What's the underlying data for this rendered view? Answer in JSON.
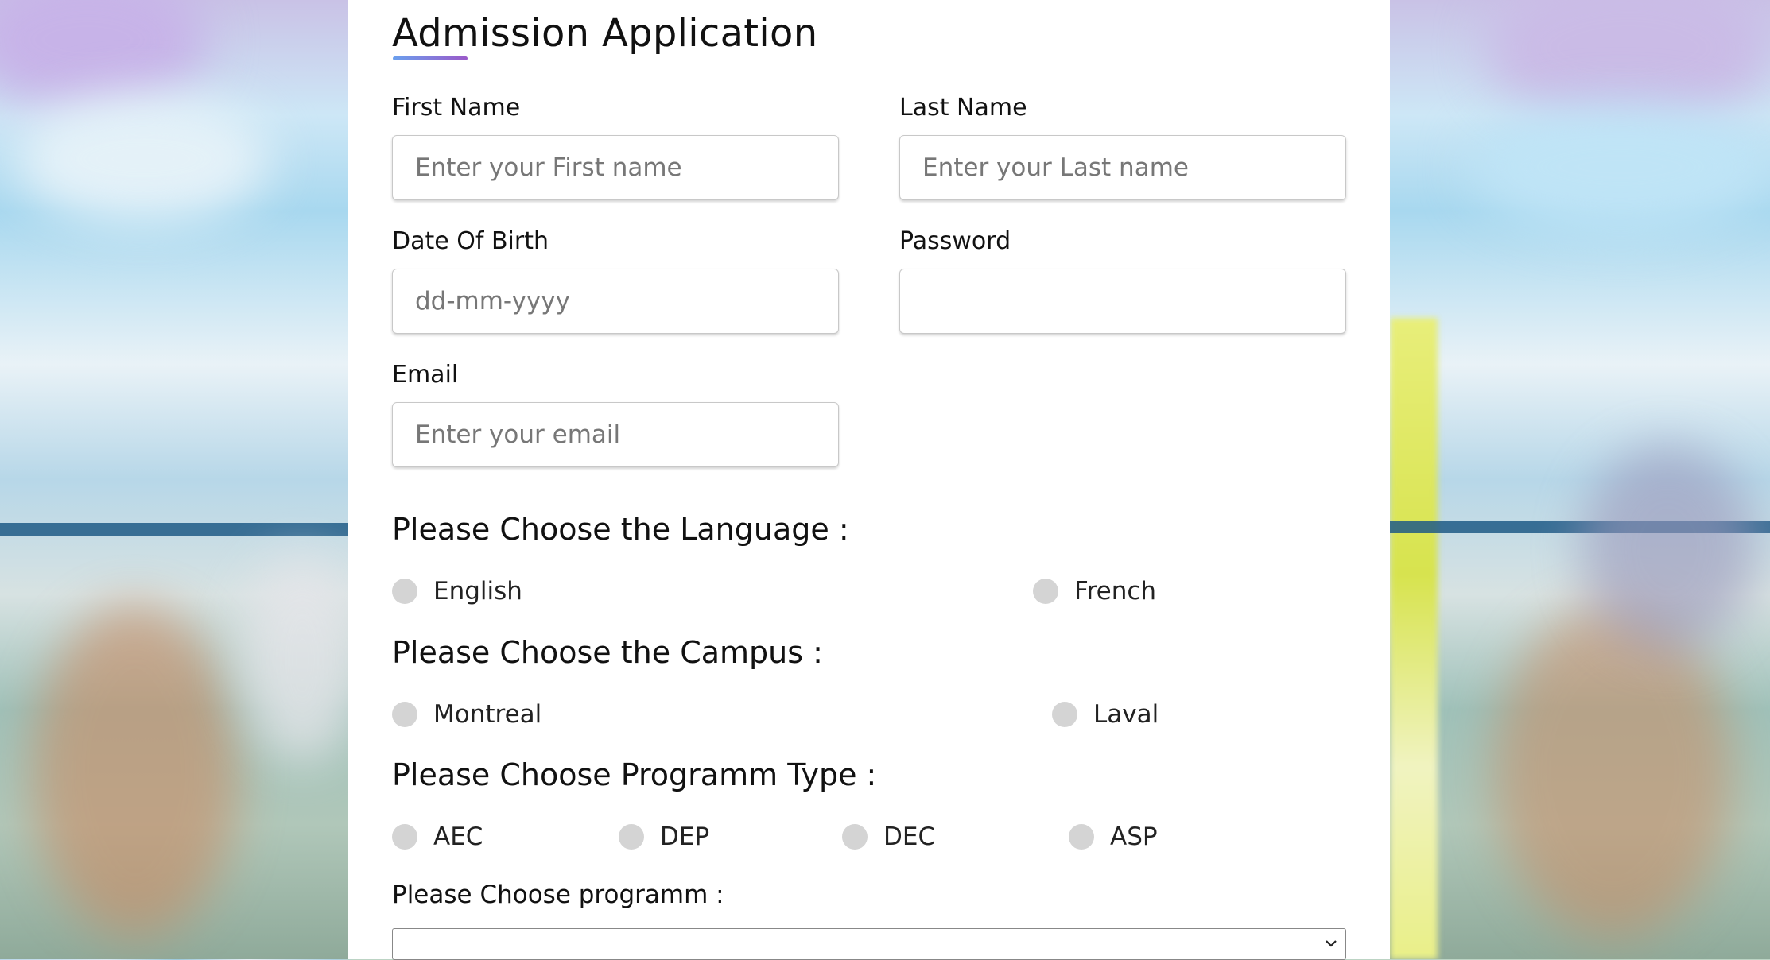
{
  "form": {
    "title": "Admission Application",
    "first_name": {
      "label": "First Name",
      "placeholder": "Enter your First name"
    },
    "last_name": {
      "label": "Last Name",
      "placeholder": "Enter your Last name"
    },
    "dob": {
      "label": "Date Of Birth",
      "placeholder": "dd-mm-yyyy"
    },
    "password": {
      "label": "Password",
      "placeholder": ""
    },
    "email": {
      "label": "Email",
      "placeholder": "Enter your email"
    },
    "language": {
      "title": "Please Choose the Language :",
      "options": [
        "English",
        "French"
      ]
    },
    "campus": {
      "title": "Please Choose the Campus :",
      "options": [
        "Montreal",
        "Laval"
      ]
    },
    "program_type": {
      "title": "Please Choose Programm Type :",
      "options": [
        "AEC",
        "DEP",
        "DEC",
        "ASP"
      ]
    },
    "program": {
      "label": "Please Choose programm :",
      "selected": ""
    }
  },
  "colors": {
    "accent_start": "#6aa0ee",
    "accent_end": "#9b59c9",
    "radio_fill": "#d4d4d4"
  }
}
